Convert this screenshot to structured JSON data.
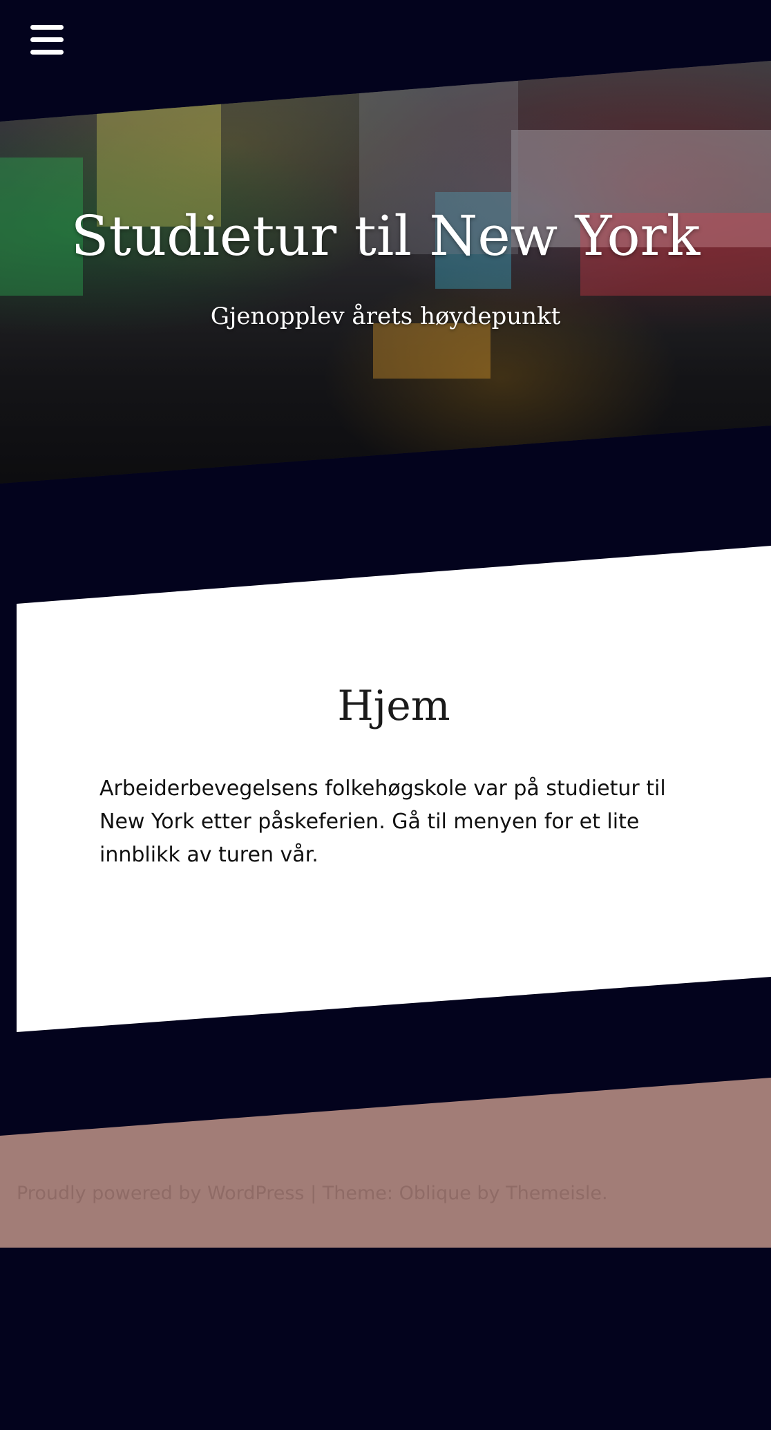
{
  "header": {
    "menu_icon": "hamburger-icon",
    "site_title": "Studietur til New York",
    "site_tagline": "Gjenopplev årets høydepunkt"
  },
  "page": {
    "title": "Hjem",
    "body": "Arbeiderbevegelsens folkehøgskole var på studietur til New York etter påskeferien. Gå til menyen for et lite innblikk av turen vår."
  },
  "footer": {
    "powered_link": "Proudly powered by WordPress",
    "separator": " | ",
    "theme_label": "Theme: Oblique by ",
    "theme_author_link": "Themeisle",
    "theme_suffix": "."
  },
  "colors": {
    "background": "#03031d",
    "card": "#ffffff",
    "footer": "#a27d77"
  }
}
